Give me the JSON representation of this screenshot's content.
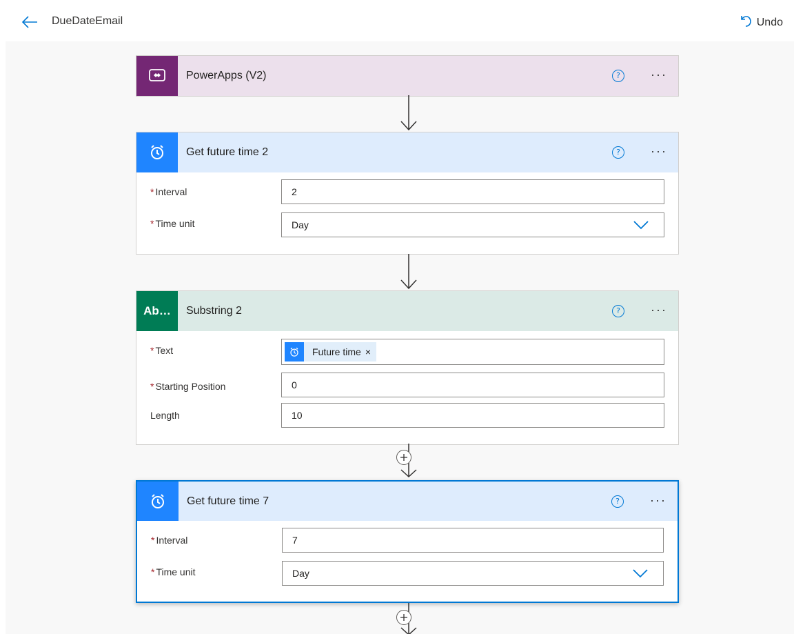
{
  "topbar": {
    "flow_name": "DueDateEmail",
    "undo_label": "Undo"
  },
  "colors": {
    "accent": "#0078d4",
    "powerapps_header": "#ece0ec",
    "powerapps_icon": "#742774",
    "schedule_header": "#deecfd",
    "schedule_icon": "#1f85ff",
    "text_header": "#dbeae6",
    "text_icon": "#007c55",
    "required": "#a4262c"
  },
  "cards": {
    "powerapps": {
      "title": "PowerApps (V2)",
      "icon": "powerapps-icon"
    },
    "future_time_2": {
      "title": "Get future time 2",
      "icon": "alarm-clock-icon",
      "interval_label": "Interval",
      "interval_value": "2",
      "time_unit_label": "Time unit",
      "time_unit_value": "Day"
    },
    "substring_2": {
      "title": "Substring 2",
      "icon_text": "Ab…",
      "text_label": "Text",
      "token_label": "Future time",
      "token_close": "×",
      "start_label": "Starting Position",
      "start_value": "0",
      "length_label": "Length",
      "length_value": "10"
    },
    "future_time_7": {
      "title": "Get future time 7",
      "icon": "alarm-clock-icon",
      "interval_label": "Interval",
      "interval_value": "7",
      "time_unit_label": "Time unit",
      "time_unit_value": "Day"
    }
  },
  "common": {
    "help_glyph": "?",
    "more_glyph": "···",
    "required_mark": "*"
  }
}
